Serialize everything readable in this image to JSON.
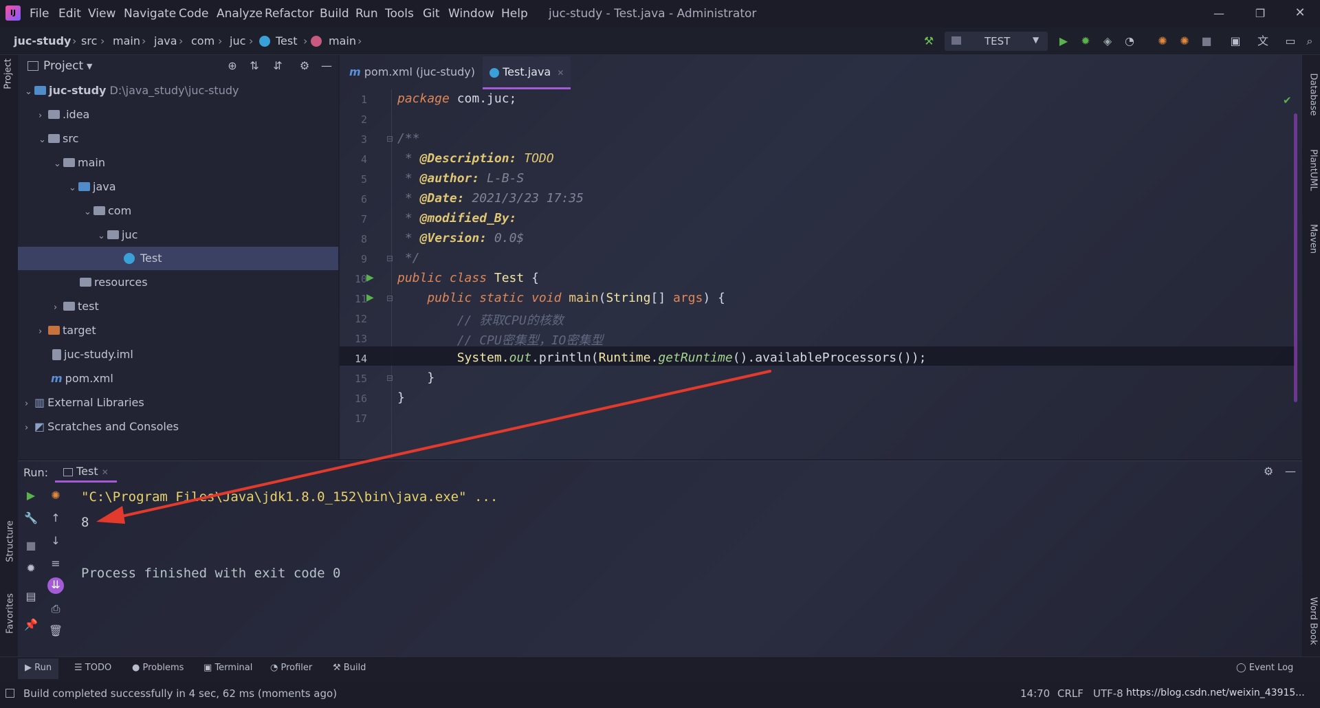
{
  "window": {
    "title": "juc-study - Test.java - Administrator",
    "menu": [
      "File",
      "Edit",
      "View",
      "Navigate",
      "Code",
      "Analyze",
      "Refactor",
      "Build",
      "Run",
      "Tools",
      "Git",
      "Window",
      "Help"
    ]
  },
  "breadcrumbs": [
    "juc-study",
    "src",
    "main",
    "java",
    "com",
    "juc",
    "Test",
    "main"
  ],
  "run_config": "TEST",
  "project": {
    "header": "Project",
    "tree": [
      {
        "label": "juc-study",
        "extra": "D:\\java_study\\juc-study"
      },
      {
        "label": ".idea"
      },
      {
        "label": "src"
      },
      {
        "label": "main"
      },
      {
        "label": "java"
      },
      {
        "label": "com"
      },
      {
        "label": "juc"
      },
      {
        "label": "Test"
      },
      {
        "label": "resources"
      },
      {
        "label": "test"
      },
      {
        "label": "target"
      },
      {
        "label": "juc-study.iml"
      },
      {
        "label": "pom.xml"
      },
      {
        "label": "External Libraries"
      },
      {
        "label": "Scratches and Consoles"
      }
    ]
  },
  "editor": {
    "tabs": [
      {
        "label": "pom.xml (juc-study)",
        "active": false
      },
      {
        "label": "Test.java",
        "active": true
      }
    ],
    "line_numbers": [
      "1",
      "2",
      "3",
      "4",
      "5",
      "6",
      "7",
      "8",
      "9",
      "10",
      "11",
      "12",
      "13",
      "14",
      "15",
      "16",
      "17"
    ],
    "code": {
      "l1_kw": "package",
      "l1_rest": " com.juc;",
      "l3": "/**",
      "l4_star": " * ",
      "l4_tag": "@Description:",
      "l4_val": " TODO",
      "l5_star": " * ",
      "l5_tag": "@author:",
      "l5_val": " L-B-S",
      "l6_star": " * ",
      "l6_tag": "@Date:",
      "l6_val": " 2021/3/23 17:35",
      "l7_star": " * ",
      "l7_tag": "@modified_By:",
      "l8_star": " * ",
      "l8_tag": "@Version:",
      "l8_val": " 0.0$",
      "l9": " */",
      "l10_kw": "public class",
      "l10_cls": " Test",
      "l10_rest": " {",
      "l11_kw": "    public static void",
      "l11_m": " main",
      "l11_p1": "(",
      "l11_t": "String",
      "l11_p2": "[] ",
      "l11_a": "args",
      "l11_p3": ") {",
      "l12": "        // 获取CPU的核数",
      "l13": "        // CPU密集型，IO密集型",
      "l14_a": "        System.",
      "l14_b": "out",
      "l14_c": ".println(",
      "l14_d": "Runtime",
      ".": "",
      "l14_e": ".",
      "l14_f": "getRuntime",
      "l14_g": "().availableProcessors());",
      "l15": "    }",
      "l16": "}"
    }
  },
  "run": {
    "label": "Run:",
    "tab": "Test",
    "console": [
      "\"C:\\Program Files\\Java\\jdk1.8.0_152\\bin\\java.exe\" ...",
      "8",
      "",
      "Process finished with exit code 0"
    ]
  },
  "side_tools": {
    "left": [
      "Project",
      "Structure",
      "Favorites"
    ],
    "right": [
      "Database",
      "PlantUML",
      "Maven",
      "Word Book"
    ]
  },
  "bottom_tabs": [
    "Run",
    "TODO",
    "Problems",
    "Terminal",
    "Profiler",
    "Build",
    "Event Log"
  ],
  "status": {
    "message": "Build completed successfully in 4 sec, 62 ms (moments ago)",
    "position": "14:70",
    "line_sep": "CRLF",
    "encoding": "UTF-8",
    "watermark": "https://blog.csdn.net/weixin_43915..."
  },
  "colors": {
    "accent": "#a45bd6",
    "keyword": "#e08757",
    "string": "#e8d36a",
    "arrow": "#e23b2e"
  }
}
